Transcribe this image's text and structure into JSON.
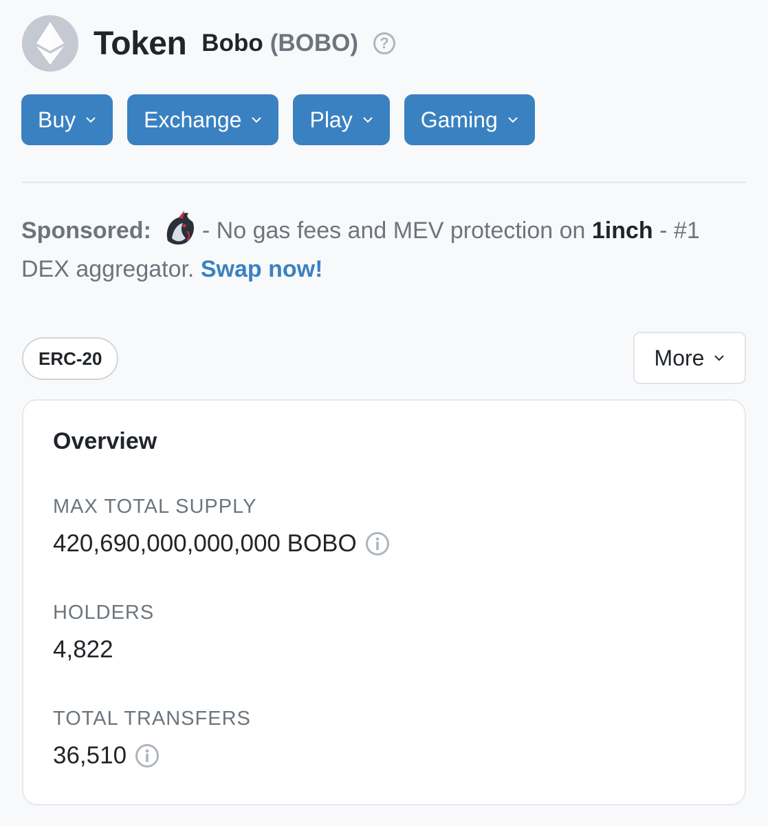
{
  "header": {
    "title": "Token",
    "token_name": "Bobo",
    "token_symbol": "(BOBO)",
    "help_glyph": "?"
  },
  "nav_buttons": [
    {
      "label": "Buy"
    },
    {
      "label": "Exchange"
    },
    {
      "label": "Play"
    },
    {
      "label": "Gaming"
    }
  ],
  "sponsored": {
    "label": "Sponsored:",
    "text_before": "- No gas fees and MEV protection on",
    "partner": "1inch",
    "text_after": "- #1 DEX aggregator.",
    "cta": "Swap now!"
  },
  "badge": {
    "label": "ERC-20"
  },
  "more_button": {
    "label": "More"
  },
  "overview": {
    "title": "Overview",
    "max_total_supply": {
      "label": "MAX TOTAL SUPPLY",
      "value": "420,690,000,000,000 BOBO"
    },
    "holders": {
      "label": "HOLDERS",
      "value": "4,822"
    },
    "total_transfers": {
      "label": "TOTAL TRANSFERS",
      "value": "36,510"
    }
  },
  "colors": {
    "accent": "#3a81c1",
    "muted_text": "#6c757d",
    "page_bg": "#f8f9fa"
  },
  "icons": [
    "ethereum-icon",
    "help-icon",
    "chevron-down-icon",
    "unicorn-logo-icon",
    "info-icon"
  ]
}
